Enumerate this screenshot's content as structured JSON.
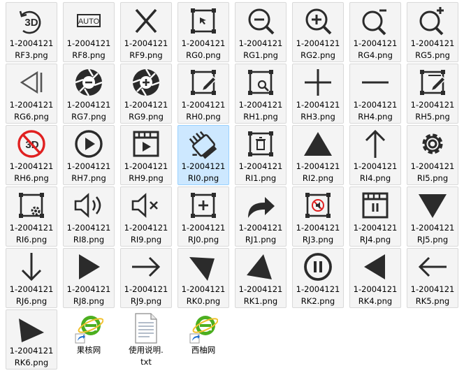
{
  "files": [
    {
      "line1": "1-2004121",
      "line2": "RF3.png",
      "icon": "3d-rotate-icon",
      "selected": false
    },
    {
      "line1": "1-2004121",
      "line2": "RF8.png",
      "icon": "auto-icon",
      "selected": false
    },
    {
      "line1": "1-2004121",
      "line2": "RF9.png",
      "icon": "close-icon",
      "selected": false
    },
    {
      "line1": "1-2004121",
      "line2": "RG0.png",
      "icon": "select-frame-icon",
      "selected": false
    },
    {
      "line1": "1-2004121",
      "line2": "RG1.png",
      "icon": "zoom-out-icon",
      "selected": false
    },
    {
      "line1": "1-2004121",
      "line2": "RG2.png",
      "icon": "zoom-in-icon",
      "selected": false
    },
    {
      "line1": "1-2004121",
      "line2": "RG4.png",
      "icon": "zoom-minus-icon",
      "selected": false
    },
    {
      "line1": "1-2004121",
      "line2": "RG5.png",
      "icon": "zoom-plus-icon",
      "selected": false
    },
    {
      "line1": "1-2004121",
      "line2": "RG6.png",
      "icon": "step-back-icon",
      "selected": false
    },
    {
      "line1": "1-2004121",
      "line2": "RG7.png",
      "icon": "aperture-minus-icon",
      "selected": false
    },
    {
      "line1": "1-2004121",
      "line2": "RG9.png",
      "icon": "aperture-plus-icon",
      "selected": false
    },
    {
      "line1": "1-2004121",
      "line2": "RH0.png",
      "icon": "frame-edit-icon",
      "selected": false
    },
    {
      "line1": "1-2004121",
      "line2": "RH1.png",
      "icon": "frame-search-icon",
      "selected": false
    },
    {
      "line1": "1-2004121",
      "line2": "RH3.png",
      "icon": "plus-icon",
      "selected": false
    },
    {
      "line1": "1-2004121",
      "line2": "RH4.png",
      "icon": "minus-icon",
      "selected": false
    },
    {
      "line1": "1-2004121",
      "line2": "RH5.png",
      "icon": "crop-edit-icon",
      "selected": false
    },
    {
      "line1": "1-2004121",
      "line2": "RH6.png",
      "icon": "no-3d-icon",
      "selected": false
    },
    {
      "line1": "1-2004121",
      "line2": "RH7.png",
      "icon": "play-circle-icon",
      "selected": false
    },
    {
      "line1": "1-2004121",
      "line2": "RH9.png",
      "icon": "video-window-icon",
      "selected": false
    },
    {
      "line1": "1-2004121",
      "line2": "RI0.png",
      "icon": "hand-pointer-icon",
      "selected": true
    },
    {
      "line1": "1-2004121",
      "line2": "RI1.png",
      "icon": "frame-trash-icon",
      "selected": false
    },
    {
      "line1": "1-2004121",
      "line2": "RI2.png",
      "icon": "triangle-up-icon",
      "selected": false
    },
    {
      "line1": "1-2004121",
      "line2": "RI4.png",
      "icon": "arrow-up-icon",
      "selected": false
    },
    {
      "line1": "1-2004121",
      "line2": "RI5.png",
      "icon": "gear-icon",
      "selected": false
    },
    {
      "line1": "1-2004121",
      "line2": "RI6.png",
      "icon": "frame-gear-icon",
      "selected": false
    },
    {
      "line1": "1-2004121",
      "line2": "RI8.png",
      "icon": "volume-icon",
      "selected": false
    },
    {
      "line1": "1-2004121",
      "line2": "RI9.png",
      "icon": "mute-icon",
      "selected": false
    },
    {
      "line1": "1-2004121",
      "line2": "RJ0.png",
      "icon": "add-frame-icon",
      "selected": false
    },
    {
      "line1": "1-2004121",
      "line2": "RJ1.png",
      "icon": "share-arrow-icon",
      "selected": false
    },
    {
      "line1": "1-2004121",
      "line2": "RJ3.png",
      "icon": "muted-box-icon",
      "selected": false
    },
    {
      "line1": "1-2004121",
      "line2": "RJ4.png",
      "icon": "pause-window-icon",
      "selected": false
    },
    {
      "line1": "1-2004121",
      "line2": "RJ5.png",
      "icon": "triangle-down-icon",
      "selected": false
    },
    {
      "line1": "1-2004121",
      "line2": "RJ6.png",
      "icon": "arrow-down-icon",
      "selected": false
    },
    {
      "line1": "1-2004121",
      "line2": "RJ8.png",
      "icon": "triangle-right-icon",
      "selected": false
    },
    {
      "line1": "1-2004121",
      "line2": "RJ9.png",
      "icon": "arrow-right-icon",
      "selected": false
    },
    {
      "line1": "1-2004121",
      "line2": "RK0.png",
      "icon": "triangle-down-right-icon",
      "selected": false
    },
    {
      "line1": "1-2004121",
      "line2": "RK1.png",
      "icon": "triangle-up-left-icon",
      "selected": false
    },
    {
      "line1": "1-2004121",
      "line2": "RK2.png",
      "icon": "pause-circle-icon",
      "selected": false
    },
    {
      "line1": "1-2004121",
      "line2": "RK4.png",
      "icon": "triangle-left-icon",
      "selected": false
    },
    {
      "line1": "1-2004121",
      "line2": "RK5.png",
      "icon": "arrow-left-icon",
      "selected": false
    },
    {
      "line1": "1-2004121",
      "line2": "RK6.png",
      "icon": "triangle-diag-icon",
      "selected": false
    }
  ],
  "shortcuts": [
    {
      "line1": "果核网",
      "line2": "",
      "icon": "ie-shortcut-icon"
    },
    {
      "line1": "使用说明.",
      "line2": "txt",
      "icon": "text-file-icon"
    },
    {
      "line1": "西柚网",
      "line2": "",
      "icon": "ie-shortcut-icon"
    }
  ],
  "colors": {
    "accent_red": "#e02020",
    "ie_green": "#4caf20",
    "ie_blue": "#1e6fd0",
    "selected_bg": "#cde8ff"
  }
}
